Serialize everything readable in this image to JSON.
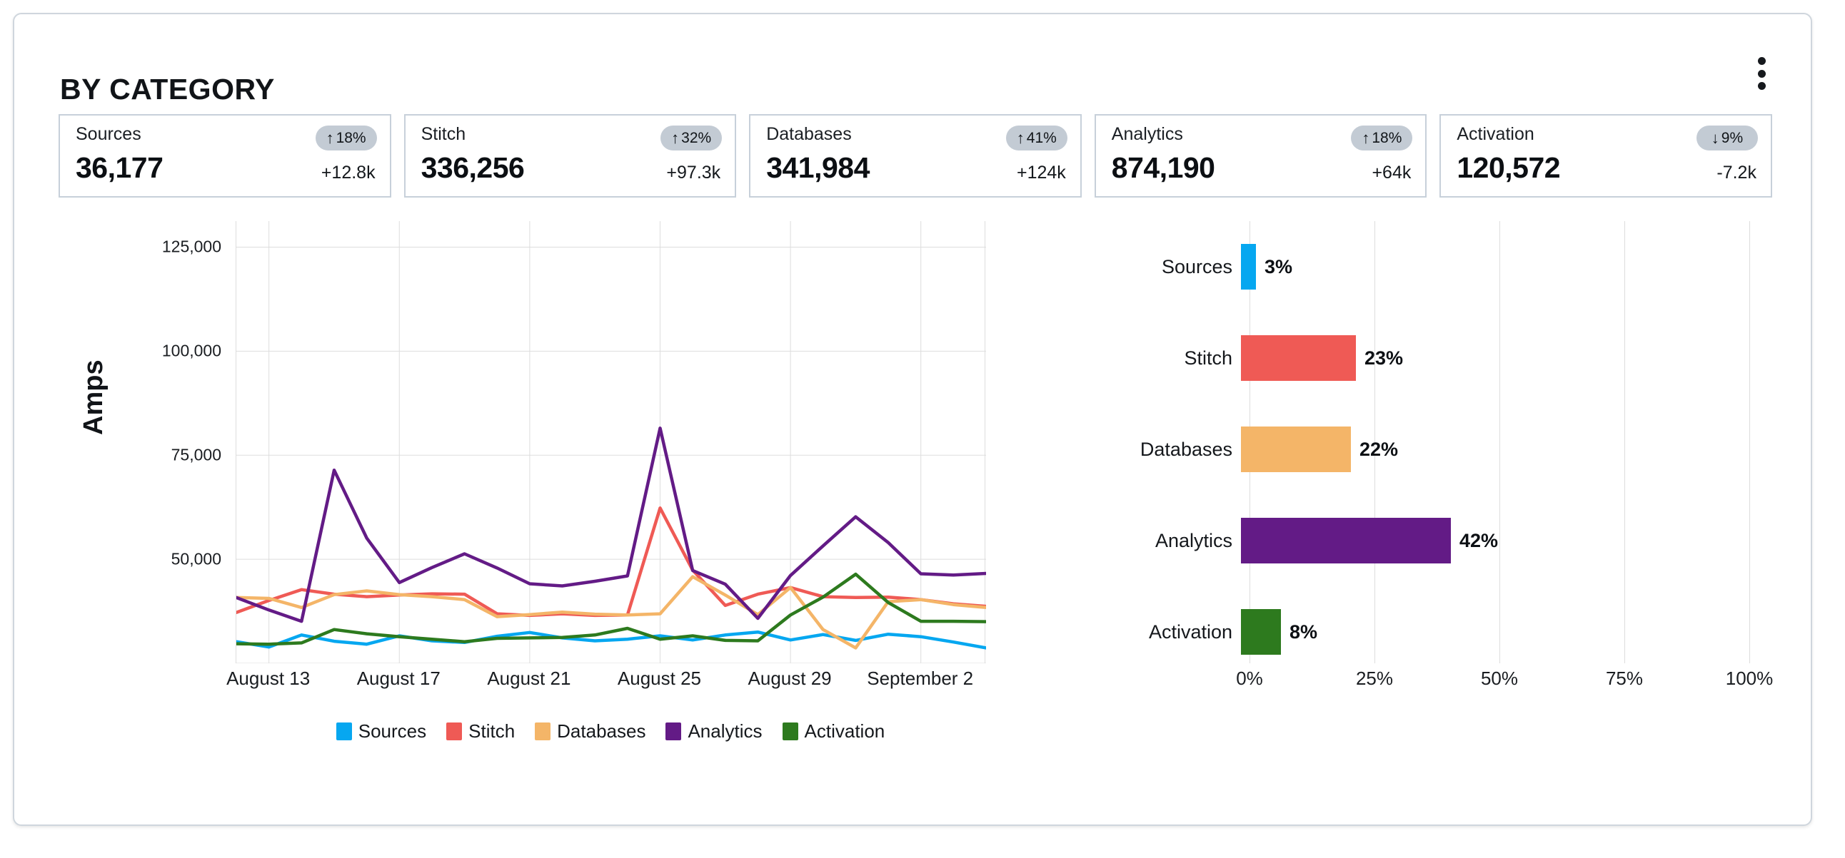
{
  "panel": {
    "title": "BY CATEGORY",
    "menu_icon": "kebab-vertical-icon"
  },
  "kpis": [
    {
      "label": "Sources",
      "value": "36,177",
      "badge_arrow": "↑",
      "badge_pct": "18%",
      "delta": "+12.8k",
      "direction": "up"
    },
    {
      "label": "Stitch",
      "value": "336,256",
      "badge_arrow": "↑",
      "badge_pct": "32%",
      "delta": "+97.3k",
      "direction": "up"
    },
    {
      "label": "Databases",
      "value": "341,984",
      "badge_arrow": "↑",
      "badge_pct": "41%",
      "delta": "+124k",
      "direction": "up"
    },
    {
      "label": "Analytics",
      "value": "874,190",
      "badge_arrow": "↑",
      "badge_pct": "18%",
      "delta": "+64k",
      "direction": "up"
    },
    {
      "label": "Activation",
      "value": "120,572",
      "badge_arrow": "↓",
      "badge_pct": "9%",
      "delta": "-7.2k",
      "direction": "down"
    }
  ],
  "colors": {
    "sources": "#06A7F0",
    "stitch": "#EF5A55",
    "databases": "#F4B568",
    "analytics": "#631B86",
    "activation": "#2D7A1E",
    "card_border": "#c7d0da",
    "badge_bg": "#c3cbd4",
    "gridline": "#dddddd"
  },
  "legend": {
    "position": "bottom",
    "items": [
      {
        "label": "Sources",
        "color": "#06A7F0"
      },
      {
        "label": "Stitch",
        "color": "#EF5A55"
      },
      {
        "label": "Databases",
        "color": "#F4B568"
      },
      {
        "label": "Analytics",
        "color": "#631B86"
      },
      {
        "label": "Activation",
        "color": "#2D7A1E"
      }
    ]
  },
  "chart_data": [
    {
      "type": "line",
      "title": "",
      "xlabel": "",
      "ylabel": "Amps",
      "ylim": [
        25000,
        131250
      ],
      "ytick_values": [
        125000,
        100000,
        75000,
        50000
      ],
      "ytick_labels": [
        "125,000",
        "100,000",
        "75,000",
        "50,000"
      ],
      "grid": true,
      "xtick_labels": [
        "August 13",
        "August 17",
        "August 21",
        "August 25",
        "August 29",
        "September 2"
      ],
      "xtick_indices": [
        1,
        5,
        9,
        13,
        17,
        21
      ],
      "x": [
        0,
        1,
        2,
        3,
        4,
        5,
        6,
        7,
        8,
        9,
        10,
        11,
        12,
        13,
        14,
        15,
        16,
        17,
        18,
        19,
        20,
        21,
        22,
        23
      ],
      "series": [
        {
          "name": "Sources",
          "color": "#06A7F0",
          "values": [
            30200,
            28900,
            31800,
            30300,
            29600,
            31600,
            30400,
            30000,
            31500,
            32400,
            31100,
            30400,
            30800,
            31600,
            30600,
            31800,
            32500,
            30600,
            31900,
            30500,
            32000,
            31400,
            30100,
            28700
          ]
        },
        {
          "name": "Stitch",
          "color": "#EF5A55",
          "values": [
            37200,
            40100,
            42700,
            41600,
            41000,
            41400,
            41700,
            41600,
            36900,
            36500,
            36900,
            36500,
            36600,
            62300,
            47400,
            38900,
            41600,
            43200,
            41000,
            40800,
            40900,
            40300,
            39300,
            38700
          ]
        },
        {
          "name": "Databases",
          "color": "#F4B568",
          "values": [
            40800,
            40600,
            38400,
            41500,
            42400,
            41500,
            41000,
            40300,
            36200,
            36700,
            37300,
            36800,
            36600,
            36900,
            45800,
            41400,
            36700,
            43200,
            33100,
            28700,
            39800,
            40300,
            39100,
            38400
          ]
        },
        {
          "name": "Analytics",
          "color": "#631B86",
          "values": [
            40800,
            37800,
            35100,
            71400,
            55100,
            44400,
            48000,
            51300,
            47900,
            44100,
            43600,
            44700,
            46000,
            81500,
            47300,
            44000,
            35800,
            46100,
            53200,
            60200,
            54000,
            46500,
            46200,
            46600
          ]
        },
        {
          "name": "Activation",
          "color": "#2D7A1E",
          "values": [
            29700,
            29600,
            29900,
            33100,
            32100,
            31400,
            30800,
            30200,
            31000,
            31100,
            31200,
            31800,
            33400,
            30800,
            31600,
            30500,
            30400,
            36600,
            40900,
            46400,
            39600,
            35100,
            35100,
            35000
          ]
        }
      ]
    },
    {
      "type": "bar",
      "orientation": "horizontal",
      "title": "",
      "xlabel": "",
      "ylabel": "",
      "xlim": [
        0,
        100
      ],
      "xtick_labels": [
        "0%",
        "25%",
        "50%",
        "75%",
        "100%"
      ],
      "xtick_values": [
        0,
        25,
        50,
        75,
        100
      ],
      "grid": true,
      "categories": [
        "Sources",
        "Stitch",
        "Databases",
        "Analytics",
        "Activation"
      ],
      "values": [
        3,
        23,
        22,
        42,
        8
      ],
      "value_labels": [
        "3%",
        "23%",
        "22%",
        "42%",
        "8%"
      ],
      "colors": [
        "#06A7F0",
        "#EF5A55",
        "#F4B568",
        "#631B86",
        "#2D7A1E"
      ]
    }
  ]
}
